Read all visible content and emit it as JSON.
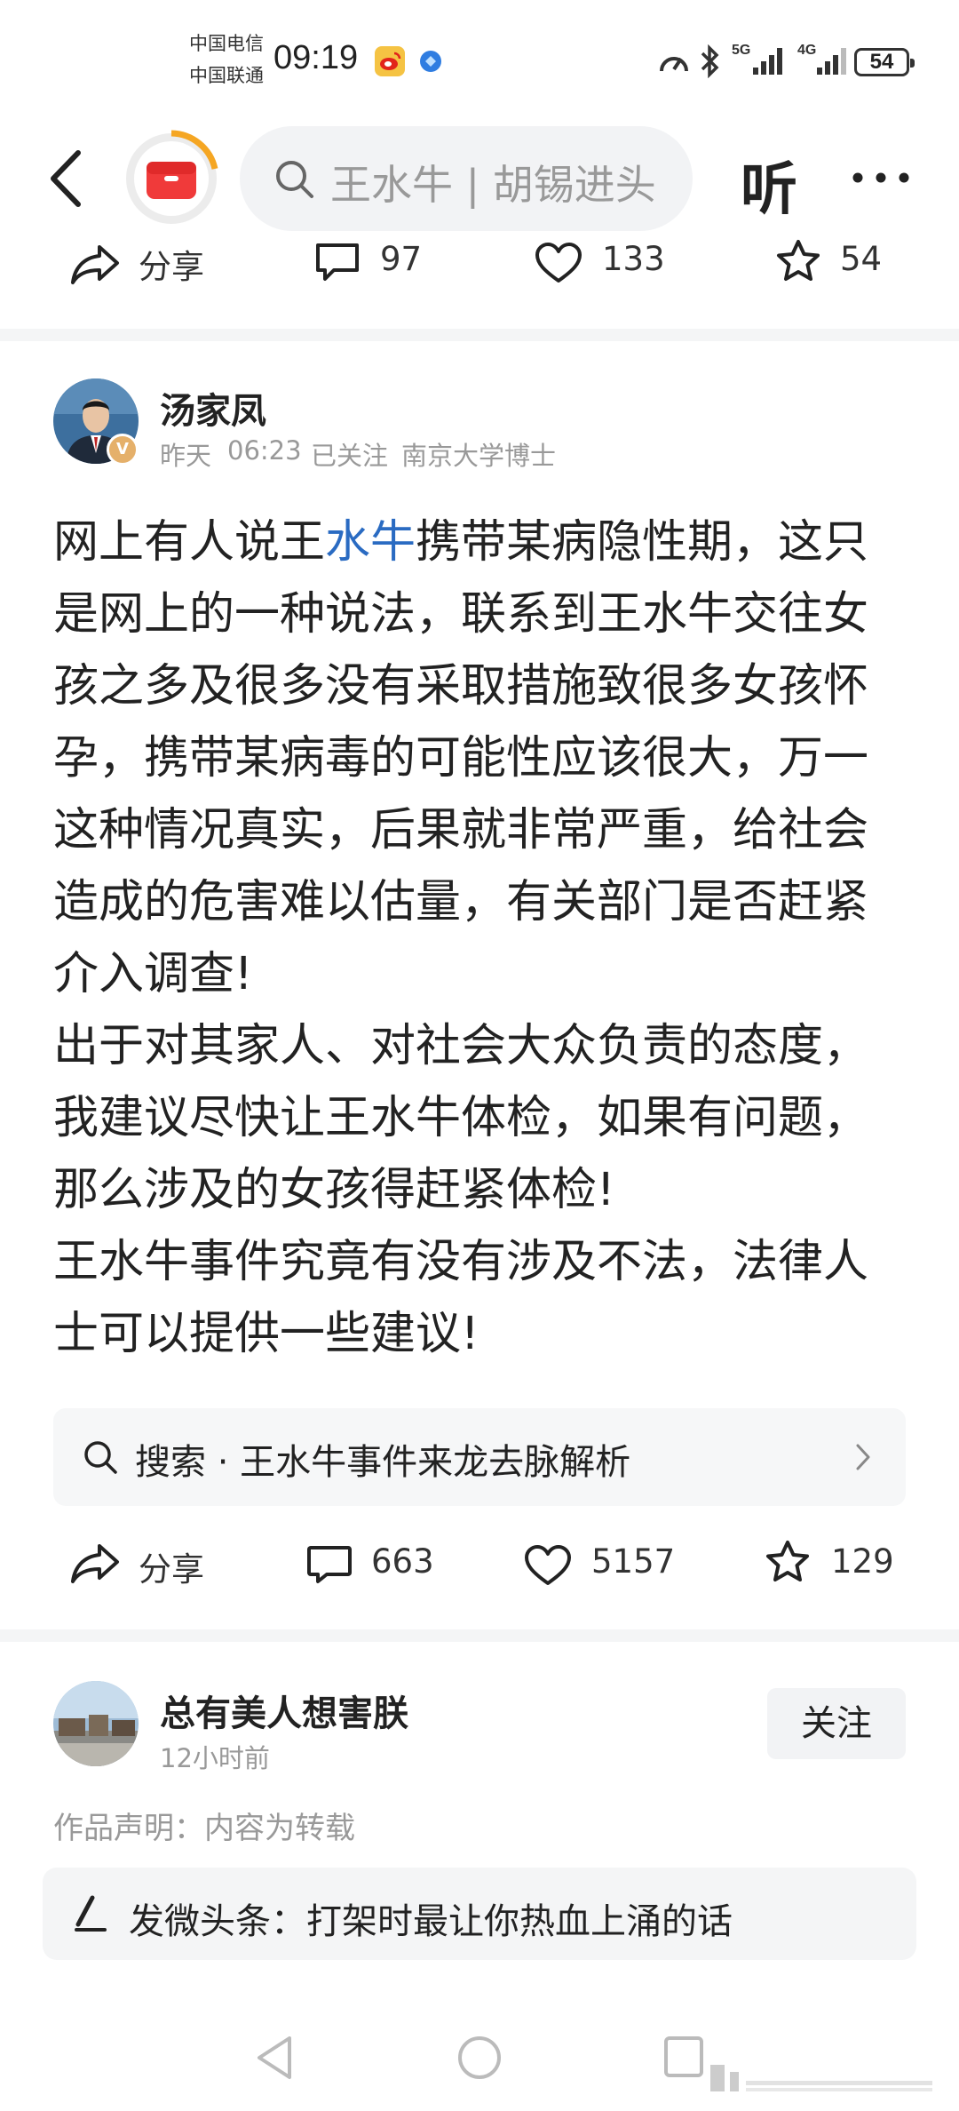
{
  "status_bar": {
    "carrier1": "中国电信",
    "carrier2": "中国联通",
    "time": "09:19",
    "net1": "5G",
    "net2": "4G",
    "battery": "54"
  },
  "nav": {
    "search_placeholder": "王水牛 | 胡锡进头",
    "listen_label": "听"
  },
  "prev_actions": {
    "share": "分享",
    "comments": "97",
    "likes": "133",
    "favorites": "54"
  },
  "post": {
    "author": "汤家凤",
    "time_label": "昨天",
    "time": "06:23",
    "follow_status": "已关注",
    "author_tag": "南京大学博士",
    "verified_badge": "V",
    "body": {
      "p1_a": "网上有人说王",
      "p1_link": "水牛",
      "p1_b": "携带某病隐性期，这只是网上的一种说法，联系到王水牛交往女孩之多及很多没有采取措施致很多女孩怀孕，携带某病毒的可能性应该很大，万一这种情况真实，后果就非常严重，给社会造成的危害难以估量，有关部门是否赶紧介入调查!",
      "p2": "出于对其家人、对社会大众负责的态度，我建议尽快让王水牛体检，如果有问题，那么涉及的女孩得赶紧体检!",
      "p3": "王水牛事件究竟有没有涉及不法，法律人士可以提供一些建议!"
    },
    "search_card": "搜索 · 王水牛事件来龙去脉解析",
    "actions": {
      "share": "分享",
      "comments": "663",
      "likes": "5157",
      "favorites": "129"
    }
  },
  "next_post": {
    "author": "总有美人想害朕",
    "time": "12小时前",
    "follow_label": "关注",
    "declaration": "作品声明：内容为转载",
    "weitoutiao": "发微头条：打架时最让你热血上涌的话"
  },
  "colors": {
    "link": "#2a6bc2",
    "verified": "#e5b06a",
    "brand_red": "#f03a3a"
  }
}
